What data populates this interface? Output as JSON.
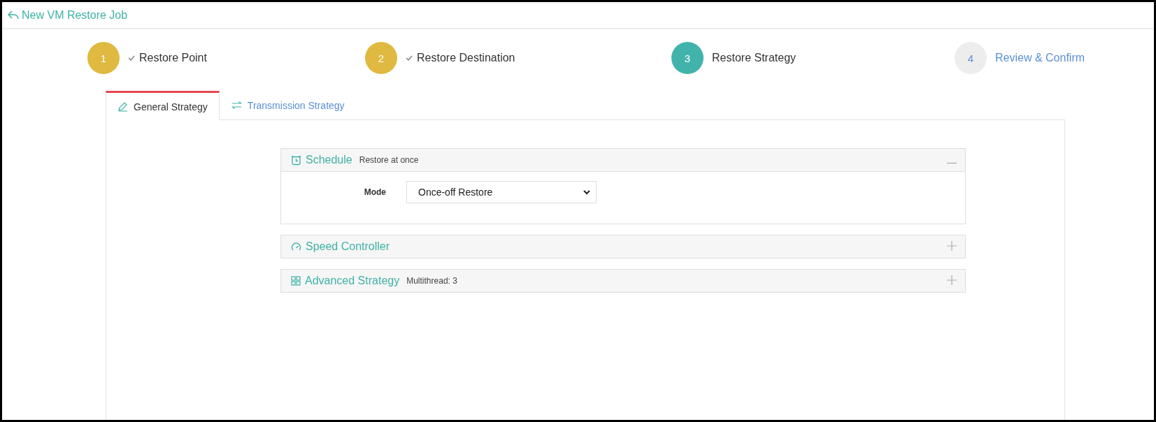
{
  "header": {
    "title": "New VM Restore Job"
  },
  "steps": [
    {
      "number": "1",
      "label": "Restore Point",
      "completed": true,
      "selected": false
    },
    {
      "number": "2",
      "label": "Restore Destination",
      "completed": true,
      "selected": false
    },
    {
      "number": "3",
      "label": "Restore Strategy",
      "completed": false,
      "selected": true
    },
    {
      "number": "4",
      "label": "Review & Confirm",
      "completed": false,
      "selected": false
    }
  ],
  "tabs": [
    {
      "label": "General Strategy",
      "selected": true
    },
    {
      "label": "Transmission Strategy",
      "selected": false
    }
  ],
  "panels": [
    {
      "title": "Schedule",
      "summary": "Restore at once",
      "expanded": true,
      "fields": [
        {
          "label": "Mode",
          "value": "Once-off Restore"
        }
      ]
    },
    {
      "title": "Speed Controller",
      "expanded": false
    },
    {
      "title": "Advanced Strategy",
      "summary": "Multithread: 3",
      "expanded": false
    }
  ]
}
